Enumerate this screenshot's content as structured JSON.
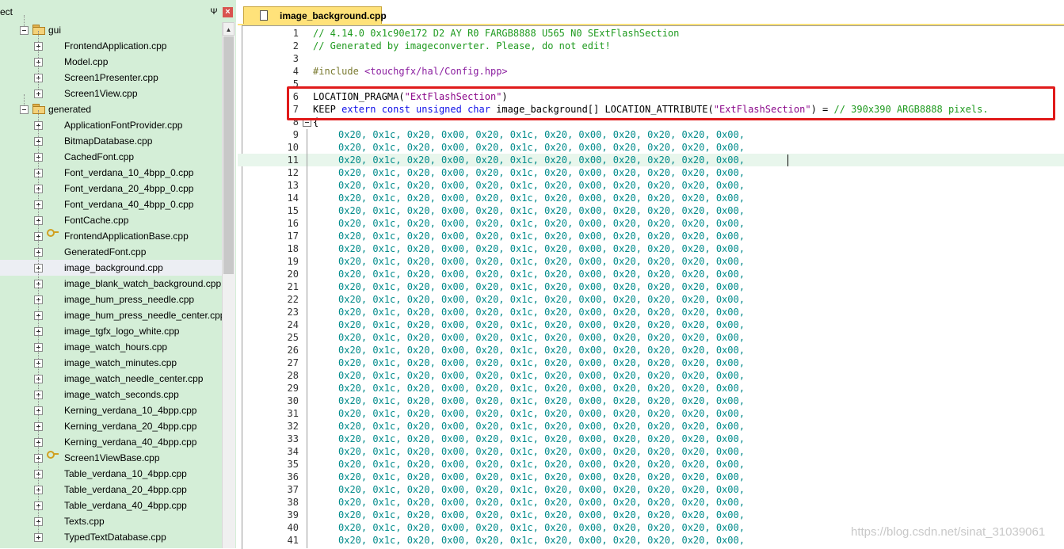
{
  "panel": {
    "title": "ect",
    "pin_icon": "pin-icon",
    "close_icon": "close-icon",
    "close_glyph": "×",
    "pin_glyph": "Ψ"
  },
  "tree": {
    "folders": [
      {
        "label": "gui",
        "expanded": true
      },
      {
        "label": "generated",
        "expanded": true
      }
    ],
    "items": [
      {
        "label": "gui",
        "kind": "folder",
        "depth": 0
      },
      {
        "label": "FrontendApplication.cpp",
        "kind": "file",
        "depth": 1
      },
      {
        "label": "Model.cpp",
        "kind": "file",
        "depth": 1
      },
      {
        "label": "Screen1Presenter.cpp",
        "kind": "file",
        "depth": 1
      },
      {
        "label": "Screen1View.cpp",
        "kind": "file",
        "depth": 1
      },
      {
        "label": "generated",
        "kind": "folder",
        "depth": 0
      },
      {
        "label": "ApplicationFontProvider.cpp",
        "kind": "file",
        "depth": 1
      },
      {
        "label": "BitmapDatabase.cpp",
        "kind": "file",
        "depth": 1
      },
      {
        "label": "CachedFont.cpp",
        "kind": "file",
        "depth": 1
      },
      {
        "label": "Font_verdana_10_4bpp_0.cpp",
        "kind": "file",
        "depth": 1
      },
      {
        "label": "Font_verdana_20_4bpp_0.cpp",
        "kind": "file",
        "depth": 1
      },
      {
        "label": "Font_verdana_40_4bpp_0.cpp",
        "kind": "file",
        "depth": 1
      },
      {
        "label": "FontCache.cpp",
        "kind": "file",
        "depth": 1
      },
      {
        "label": "FrontendApplicationBase.cpp",
        "kind": "keyfile",
        "depth": 1
      },
      {
        "label": "GeneratedFont.cpp",
        "kind": "file",
        "depth": 1
      },
      {
        "label": "image_background.cpp",
        "kind": "file",
        "depth": 1,
        "selected": true
      },
      {
        "label": "image_blank_watch_background.cpp",
        "kind": "file",
        "depth": 1
      },
      {
        "label": "image_hum_press_needle.cpp",
        "kind": "file",
        "depth": 1
      },
      {
        "label": "image_hum_press_needle_center.cpp",
        "kind": "file",
        "depth": 1
      },
      {
        "label": "image_tgfx_logo_white.cpp",
        "kind": "file",
        "depth": 1
      },
      {
        "label": "image_watch_hours.cpp",
        "kind": "file",
        "depth": 1
      },
      {
        "label": "image_watch_minutes.cpp",
        "kind": "file",
        "depth": 1
      },
      {
        "label": "image_watch_needle_center.cpp",
        "kind": "file",
        "depth": 1
      },
      {
        "label": "image_watch_seconds.cpp",
        "kind": "file",
        "depth": 1
      },
      {
        "label": "Kerning_verdana_10_4bpp.cpp",
        "kind": "file",
        "depth": 1
      },
      {
        "label": "Kerning_verdana_20_4bpp.cpp",
        "kind": "file",
        "depth": 1
      },
      {
        "label": "Kerning_verdana_40_4bpp.cpp",
        "kind": "file",
        "depth": 1
      },
      {
        "label": "Screen1ViewBase.cpp",
        "kind": "keyfile",
        "depth": 1
      },
      {
        "label": "Table_verdana_10_4bpp.cpp",
        "kind": "file",
        "depth": 1
      },
      {
        "label": "Table_verdana_20_4bpp.cpp",
        "kind": "file",
        "depth": 1
      },
      {
        "label": "Table_verdana_40_4bpp.cpp",
        "kind": "file",
        "depth": 1
      },
      {
        "label": "Texts.cpp",
        "kind": "file",
        "depth": 1
      },
      {
        "label": "TypedTextDatabase.cpp",
        "kind": "file",
        "depth": 1
      }
    ]
  },
  "editor": {
    "tab_label": "image_background.cpp",
    "current_line": 11,
    "lines": [
      {
        "n": 1,
        "tokens": [
          [
            "comment",
            "// 4.14.0 0x1c90e172 D2 AY R0 FARGB8888 U565 N0 SExtFlashSection"
          ]
        ]
      },
      {
        "n": 2,
        "tokens": [
          [
            "comment",
            "// Generated by imageconverter. Please, do not edit!"
          ]
        ]
      },
      {
        "n": 3,
        "tokens": []
      },
      {
        "n": 4,
        "tokens": [
          [
            "pre",
            "#include "
          ],
          [
            "inc",
            "<touchgfx/hal/Config.hpp>"
          ]
        ]
      },
      {
        "n": 5,
        "tokens": []
      },
      {
        "n": 6,
        "tokens": [
          [
            "plain",
            "LOCATION_PRAGMA("
          ],
          [
            "str",
            "\"ExtFlashSection\""
          ],
          [
            "plain",
            ")"
          ]
        ]
      },
      {
        "n": 7,
        "tokens": [
          [
            "plain",
            "KEEP "
          ],
          [
            "kw",
            "extern const unsigned char"
          ],
          [
            "plain",
            " image_background[] LOCATION_ATTRIBUTE("
          ],
          [
            "str",
            "\"ExtFlashSection\""
          ],
          [
            "plain",
            ") = "
          ],
          [
            "comment",
            "// 390x390 ARGB8888 pixels."
          ]
        ]
      },
      {
        "n": 8,
        "tokens": [
          [
            "plain",
            "{"
          ]
        ]
      }
    ],
    "data_row_text": "0x20, 0x1c, 0x20, 0x00, 0x20, 0x1c, 0x20, 0x00, 0x20, 0x20, 0x20, 0x00,",
    "data_line_start": 9,
    "data_line_end": 41
  },
  "watermark": "https://blog.csdn.net/sinat_31039061",
  "colors": {
    "panel_bg": "#d4eed7",
    "tab_bg": "#ffe27a",
    "highlight_box": "#e01a1a",
    "comment": "#1f9a1f",
    "keyword": "#1010e8",
    "string": "#8b0a8b",
    "number": "#008b8b"
  }
}
